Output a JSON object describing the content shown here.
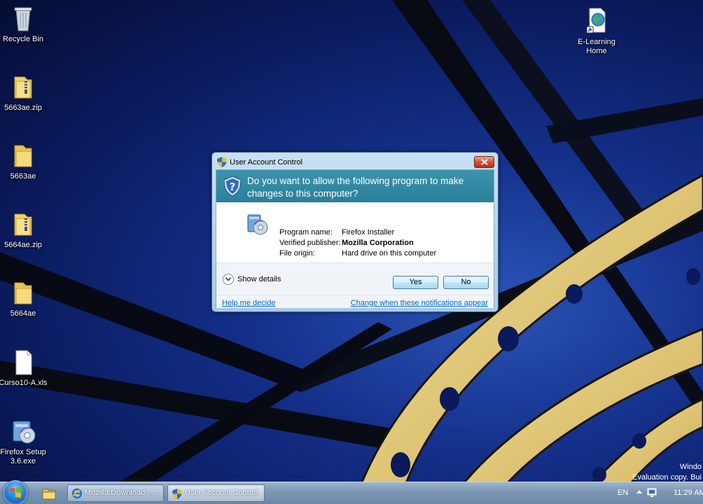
{
  "desktop": {
    "icons": [
      {
        "label": "Recycle Bin",
        "icon": "recycle-bin-icon"
      },
      {
        "label": "5663ae.zip",
        "icon": "zip-folder-icon"
      },
      {
        "label": "5663ae",
        "icon": "folder-icon"
      },
      {
        "label": "5664ae.zip",
        "icon": "zip-folder-icon"
      },
      {
        "label": "5664ae",
        "icon": "folder-icon"
      },
      {
        "label": "Curso10-A.xls",
        "icon": "document-icon"
      },
      {
        "label": "Firefox Setup 3.6.exe",
        "icon": "installer-icon"
      },
      {
        "label": "E-Learning Home",
        "icon": "internet-shortcut-icon"
      }
    ],
    "watermark": {
      "line1": "Windo",
      "line2": "Evaluation copy. Bui"
    }
  },
  "dialog": {
    "title": "User Account Control",
    "question": "Do you want to allow the following program to make changes to this computer?",
    "program_name_label": "Program name:",
    "program_name": "Firefox Installer",
    "publisher_label": "Verified publisher:",
    "publisher": "Mozilla Corporation",
    "origin_label": "File origin:",
    "origin": "Hard drive on this computer",
    "show_details": "Show details",
    "yes": "Yes",
    "no": "No",
    "help_link": "Help me decide",
    "change_link": "Change when these notifications appear"
  },
  "taskbar": {
    "buttons": [
      {
        "label": "Mozilla Download - ...",
        "icon": "ie-icon"
      },
      {
        "label": "User Account Control",
        "icon": "uac-shield-icon"
      }
    ],
    "tray": {
      "language": "EN",
      "clock": "11:29 AM"
    }
  },
  "colors": {
    "uac_banner": "#2a7f9a",
    "link": "#0066cc",
    "wallpaper_arch": "#e8d27a"
  }
}
